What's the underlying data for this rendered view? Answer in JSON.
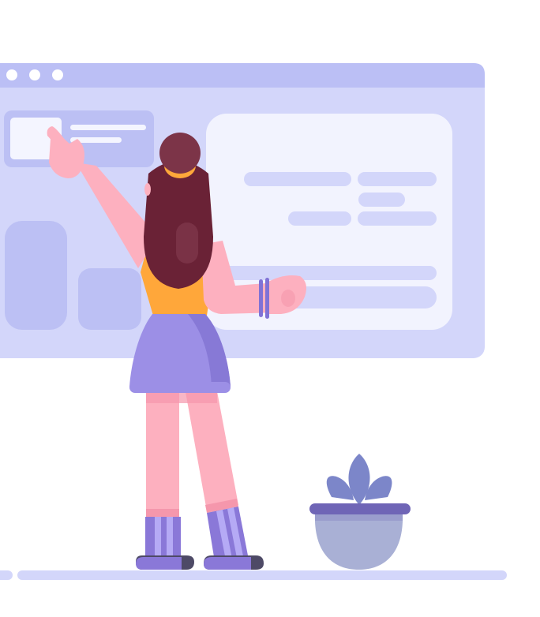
{
  "illustration": {
    "colors": {
      "window_bar": "#BBBFF5",
      "window_body": "#D3D6FA",
      "panel": "#F2F3FE",
      "placeholder": "#BCC0F4",
      "line_light": "#F4F5FF",
      "skin": "#FDB0BF",
      "skin_shadow": "#F597AC",
      "hair": "#6A2236",
      "hair_bun": "#7C3448",
      "shirt": "#FFA73A",
      "skirt": "#9C8FE6",
      "skirt_shadow": "#8779D6",
      "boot": "#8A78D8",
      "boot_stripe": "#B5AAF5",
      "sole": "#4E4A66",
      "pot": "#A9B0D5",
      "pot_rim": "#6F65B6",
      "plant": "#7C86C9",
      "floor": "#D3D6FA",
      "bangle": "#8072D6"
    },
    "icons": [
      "window-dot-icon",
      "plant-icon"
    ]
  }
}
